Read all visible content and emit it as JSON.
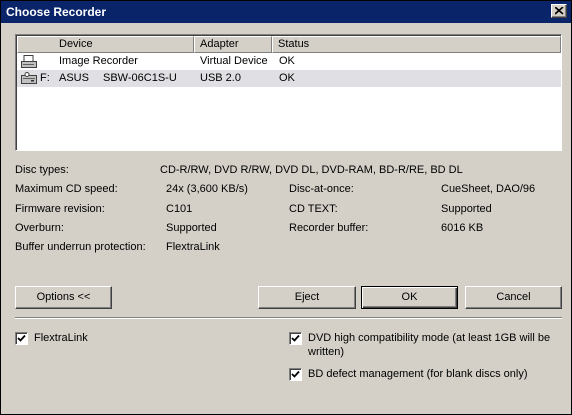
{
  "window": {
    "title": "Choose Recorder"
  },
  "list": {
    "columns": [
      "Device",
      "Adapter",
      "Status"
    ],
    "rows": [
      {
        "letter": "",
        "vendor": "Image Recorder",
        "model": "",
        "adapter": "Virtual Device",
        "status": "OK",
        "icon": "image-recorder-icon"
      },
      {
        "letter": "F:",
        "vendor": "ASUS",
        "model": "SBW-06C1S-U",
        "adapter": "USB 2.0",
        "status": "OK",
        "icon": "optical-drive-icon"
      }
    ]
  },
  "info": {
    "disc_types_label": "Disc types:",
    "disc_types_value": "CD-R/RW, DVD R/RW, DVD DL, DVD-RAM, BD-R/RE, BD DL",
    "max_cd_speed_label": "Maximum CD speed:",
    "max_cd_speed_value": "24x (3,600 KB/s)",
    "firmware_label": "Firmware revision:",
    "firmware_value": "C101",
    "overburn_label": "Overburn:",
    "overburn_value": "Supported",
    "buffer_underrun_label": "Buffer underrun protection:",
    "buffer_underrun_value": "FlextraLink",
    "dao_label": "Disc-at-once:",
    "dao_value": "CueSheet, DAO/96",
    "cdtext_label": "CD TEXT:",
    "cdtext_value": "Supported",
    "recorder_buffer_label": "Recorder buffer:",
    "recorder_buffer_value": "6016 KB"
  },
  "buttons": {
    "options": "Options <<",
    "eject": "Eject",
    "ok": "OK",
    "cancel": "Cancel"
  },
  "options": {
    "flextralink": {
      "label": "FlextraLink",
      "checked": true
    },
    "dvd_high_compat": {
      "label_line1": "DVD high compatibility mode (at least 1GB will be",
      "label_line2": "written)",
      "checked": true
    },
    "bd_defect": {
      "label": "BD defect management (for blank discs only)",
      "checked": true
    }
  }
}
